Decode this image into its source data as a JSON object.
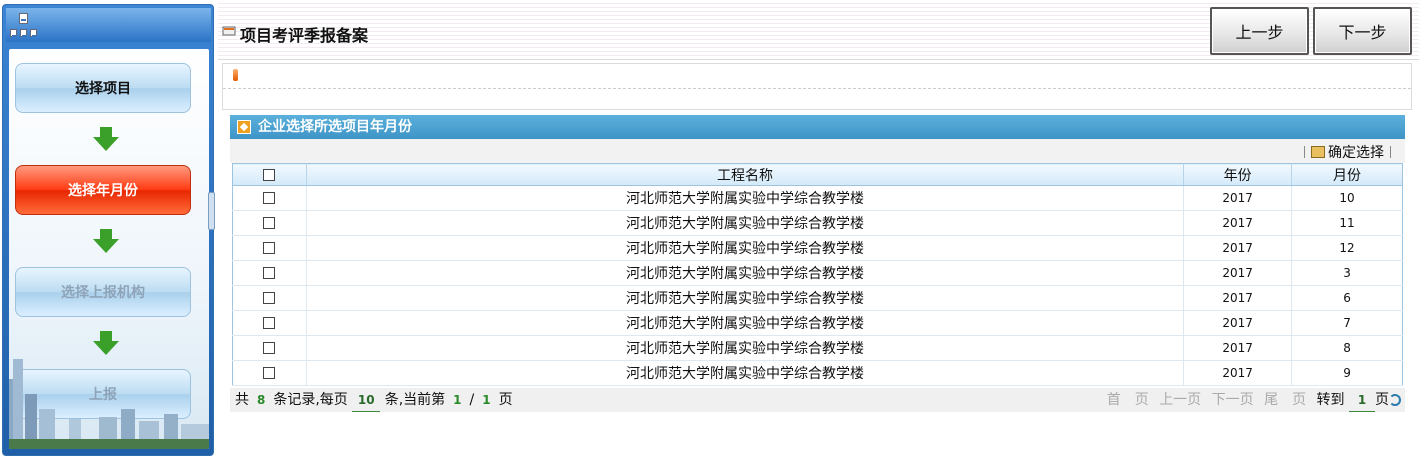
{
  "sidebar": {
    "steps": [
      {
        "label": "选择项目",
        "state": "normal"
      },
      {
        "label": "选择年月份",
        "state": "active"
      },
      {
        "label": "选择上报机构",
        "state": "disabled"
      },
      {
        "label": "上报",
        "state": "disabled"
      }
    ]
  },
  "header": {
    "title": "项目考评季报备案",
    "prev_label": "上一步",
    "next_label": "下一步"
  },
  "panel": {
    "title": "企业选择所选项目年月份",
    "confirm_label": "确定选择"
  },
  "table": {
    "columns": [
      "工程名称",
      "年份",
      "月份"
    ],
    "rows": [
      {
        "name": "河北师范大学附属实验中学综合教学楼",
        "year": "2017",
        "month": "10"
      },
      {
        "name": "河北师范大学附属实验中学综合教学楼",
        "year": "2017",
        "month": "11"
      },
      {
        "name": "河北师范大学附属实验中学综合教学楼",
        "year": "2017",
        "month": "12"
      },
      {
        "name": "河北师范大学附属实验中学综合教学楼",
        "year": "2017",
        "month": "3"
      },
      {
        "name": "河北师范大学附属实验中学综合教学楼",
        "year": "2017",
        "month": "6"
      },
      {
        "name": "河北师范大学附属实验中学综合教学楼",
        "year": "2017",
        "month": "7"
      },
      {
        "name": "河北师范大学附属实验中学综合教学楼",
        "year": "2017",
        "month": "8"
      },
      {
        "name": "河北师范大学附属实验中学综合教学楼",
        "year": "2017",
        "month": "9"
      }
    ]
  },
  "pager": {
    "prefix": "共",
    "total": "8",
    "records_per_page": "条记录,每页",
    "page_size": "10",
    "current_page_label": "条,当前第",
    "current": "1",
    "slash": "/",
    "pages": "1",
    "page_suffix": "页",
    "first": "首　页",
    "prev": "上一页",
    "next": "下一页",
    "last": "尾　页",
    "goto": "转到",
    "goto_value": "1",
    "goto_suffix": "页"
  },
  "colors": {
    "accent": "#3e94c6",
    "active_step": "#ff3a12"
  }
}
